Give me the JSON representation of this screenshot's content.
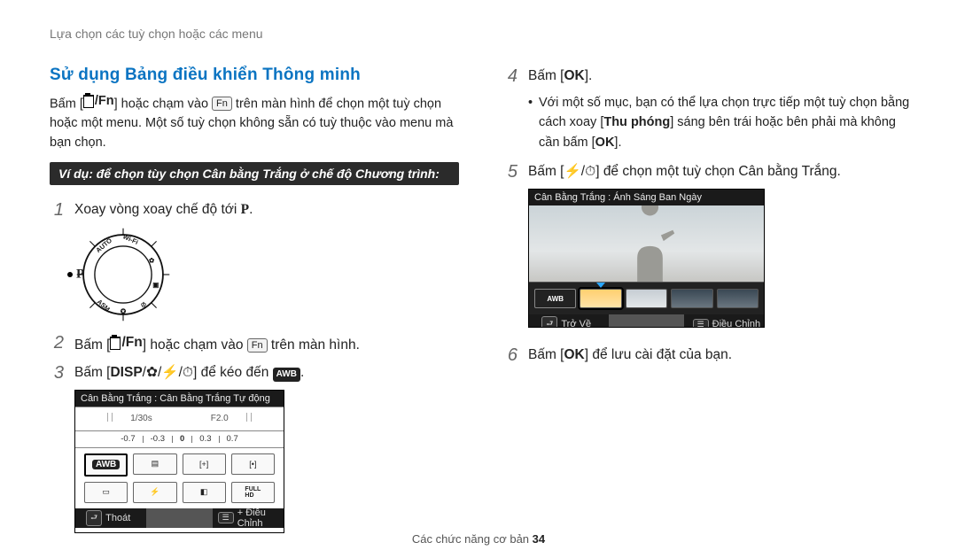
{
  "breadcrumb": "Lựa chọn các tuỳ chọn hoặc các menu",
  "section_title": "Sử dụng Bảng điều khiển Thông minh",
  "intro": {
    "part1": "Bấm [",
    "fn_text": "/Fn",
    "part2": "] hoặc chạm vào ",
    "fn_chip": "Fn",
    "part3": " trên màn hình để chọn một tuỳ chọn hoặc một menu. Một số tuỳ chọn không sẵn có tuỳ thuộc vào menu mà bạn chọn."
  },
  "example_bar": "Ví dụ: để chọn tùy chọn Cân bằng Trắng ở chế độ Chương trình:",
  "steps": {
    "s1_pre": "Xoay vòng xoay chế độ tới ",
    "s1_mode": "P",
    "s1_post": ".",
    "dial_labels": {
      "auto": "AUTO",
      "wifi": "Wi-Fi",
      "asm": "ASM"
    },
    "s2_pre": "Bấm [",
    "s2_fn": "/Fn",
    "s2_mid": "] hoặc chạm vào ",
    "s2_chip": "Fn",
    "s2_post": " trên màn hình.",
    "s3_pre": "Bấm [",
    "s3_disp": "DISP",
    "s3_sep": "/",
    "s3_post": "] để kéo đến ",
    "s3_awb": "AWB",
    "s3_end": ".",
    "s4_pre": "Bấm [",
    "s4_ok": "OK",
    "s4_post": "].",
    "s4_bullet_pre": "Với một số mục, bạn có thể lựa chọn trực tiếp một tuỳ chọn bằng cách xoay [",
    "s4_bullet_bold": "Thu phóng",
    "s4_bullet_mid": "] sáng bên trái hoặc bên phải mà không cần bấm [",
    "s4_bullet_ok": "OK",
    "s4_bullet_post": "].",
    "s5_pre": "Bấm [",
    "s5_sep": "/",
    "s5_post": "] để chọn một tuỳ chọn Cân bằng Trắng.",
    "s6_pre": "Bấm [",
    "s6_ok": "OK",
    "s6_post": "] để lưu cài đặt của bạn."
  },
  "ui1": {
    "top": "Cân Bằng Trắng : Cân Bằng Trắng Tự động",
    "mid_left": "1/30s",
    "mid_right": "F2.0",
    "slider": [
      "-0.7",
      "-0.3",
      "0",
      "0.3",
      "0.7"
    ],
    "bot_left_chip": "⮐",
    "bot_left": "Thoát",
    "bot_right_chip": "☰",
    "bot_right": "+  Điều Chỉnh",
    "awb_label": "AWB"
  },
  "ui2": {
    "top": "Cân Bằng Trắng : Ánh Sáng Ban Ngày",
    "thumbs_awb": "AWB",
    "bot_left_chip": "⮐",
    "bot_left": "Trở Về",
    "bot_right_chip": "☰",
    "bot_right": "Điều Chỉnh"
  },
  "footer": {
    "label": "Các chức năng cơ bản  ",
    "page": "34"
  }
}
